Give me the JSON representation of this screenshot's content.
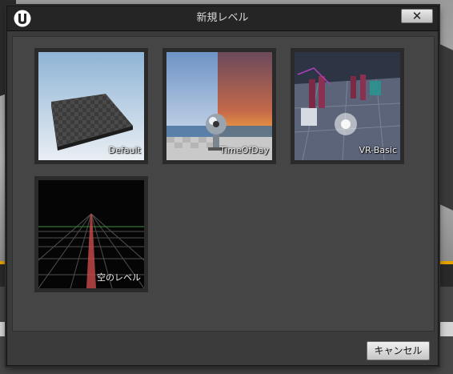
{
  "dialog": {
    "title": "新規レベル",
    "close_label": "✕",
    "cancel_label": "キャンセル"
  },
  "templates": [
    {
      "label": "Default"
    },
    {
      "label": "TimeOfDay"
    },
    {
      "label": "VR-Basic"
    },
    {
      "label": "空のレベル"
    }
  ],
  "colors": {
    "accent": "#e6a300",
    "dialog_bg": "#3b3b3b",
    "titlebar_bg": "#252525"
  },
  "icons": [
    "unreal-logo-icon",
    "close-icon"
  ]
}
